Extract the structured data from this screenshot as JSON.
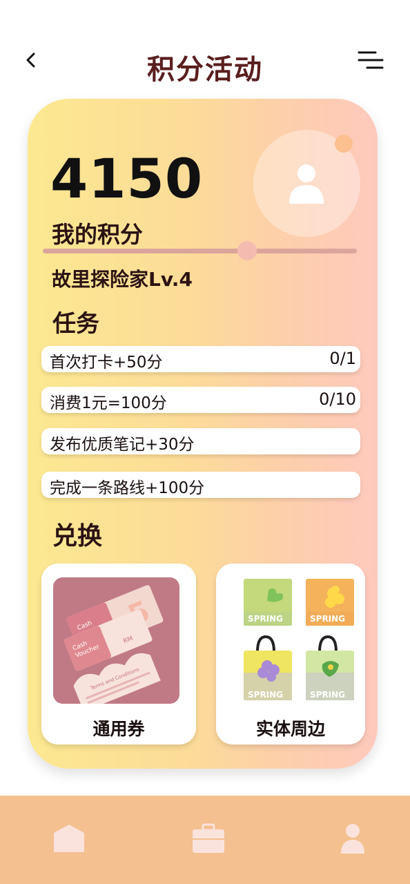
{
  "header": {
    "title": "积分活动",
    "back_icon": "chevron-left-icon",
    "menu_icon": "menu-icon"
  },
  "points": {
    "value": "4150",
    "label": "我的积分",
    "level_progress": 0.65
  },
  "level": "故里探险家Lv.4",
  "tasks": {
    "title": "任务",
    "items": [
      {
        "label": "首次打卡+50分",
        "progress": "0/1"
      },
      {
        "label": "消费1元=100分",
        "progress": "0/10"
      },
      {
        "label": "发布优质笔记+30分",
        "progress": ""
      },
      {
        "label": "完成一条路线+100分",
        "progress": ""
      }
    ]
  },
  "exchange": {
    "title": "兑换",
    "items": [
      {
        "label": "通用券"
      },
      {
        "label": "实体周边"
      }
    ],
    "voucher_text": [
      "Cash",
      "Voucher",
      "Cash",
      "Voucher",
      "RM",
      "5",
      "Terms and Conditions"
    ],
    "merch_text": "SPRING"
  },
  "nav": {
    "icons": [
      "home-icon",
      "briefcase-icon",
      "user-icon"
    ]
  },
  "colors": {
    "title": "#5a1e1e",
    "card_gradient_start": "#fce891",
    "card_gradient_end": "#fec9bd",
    "nav_bg": "#f4c08f"
  }
}
